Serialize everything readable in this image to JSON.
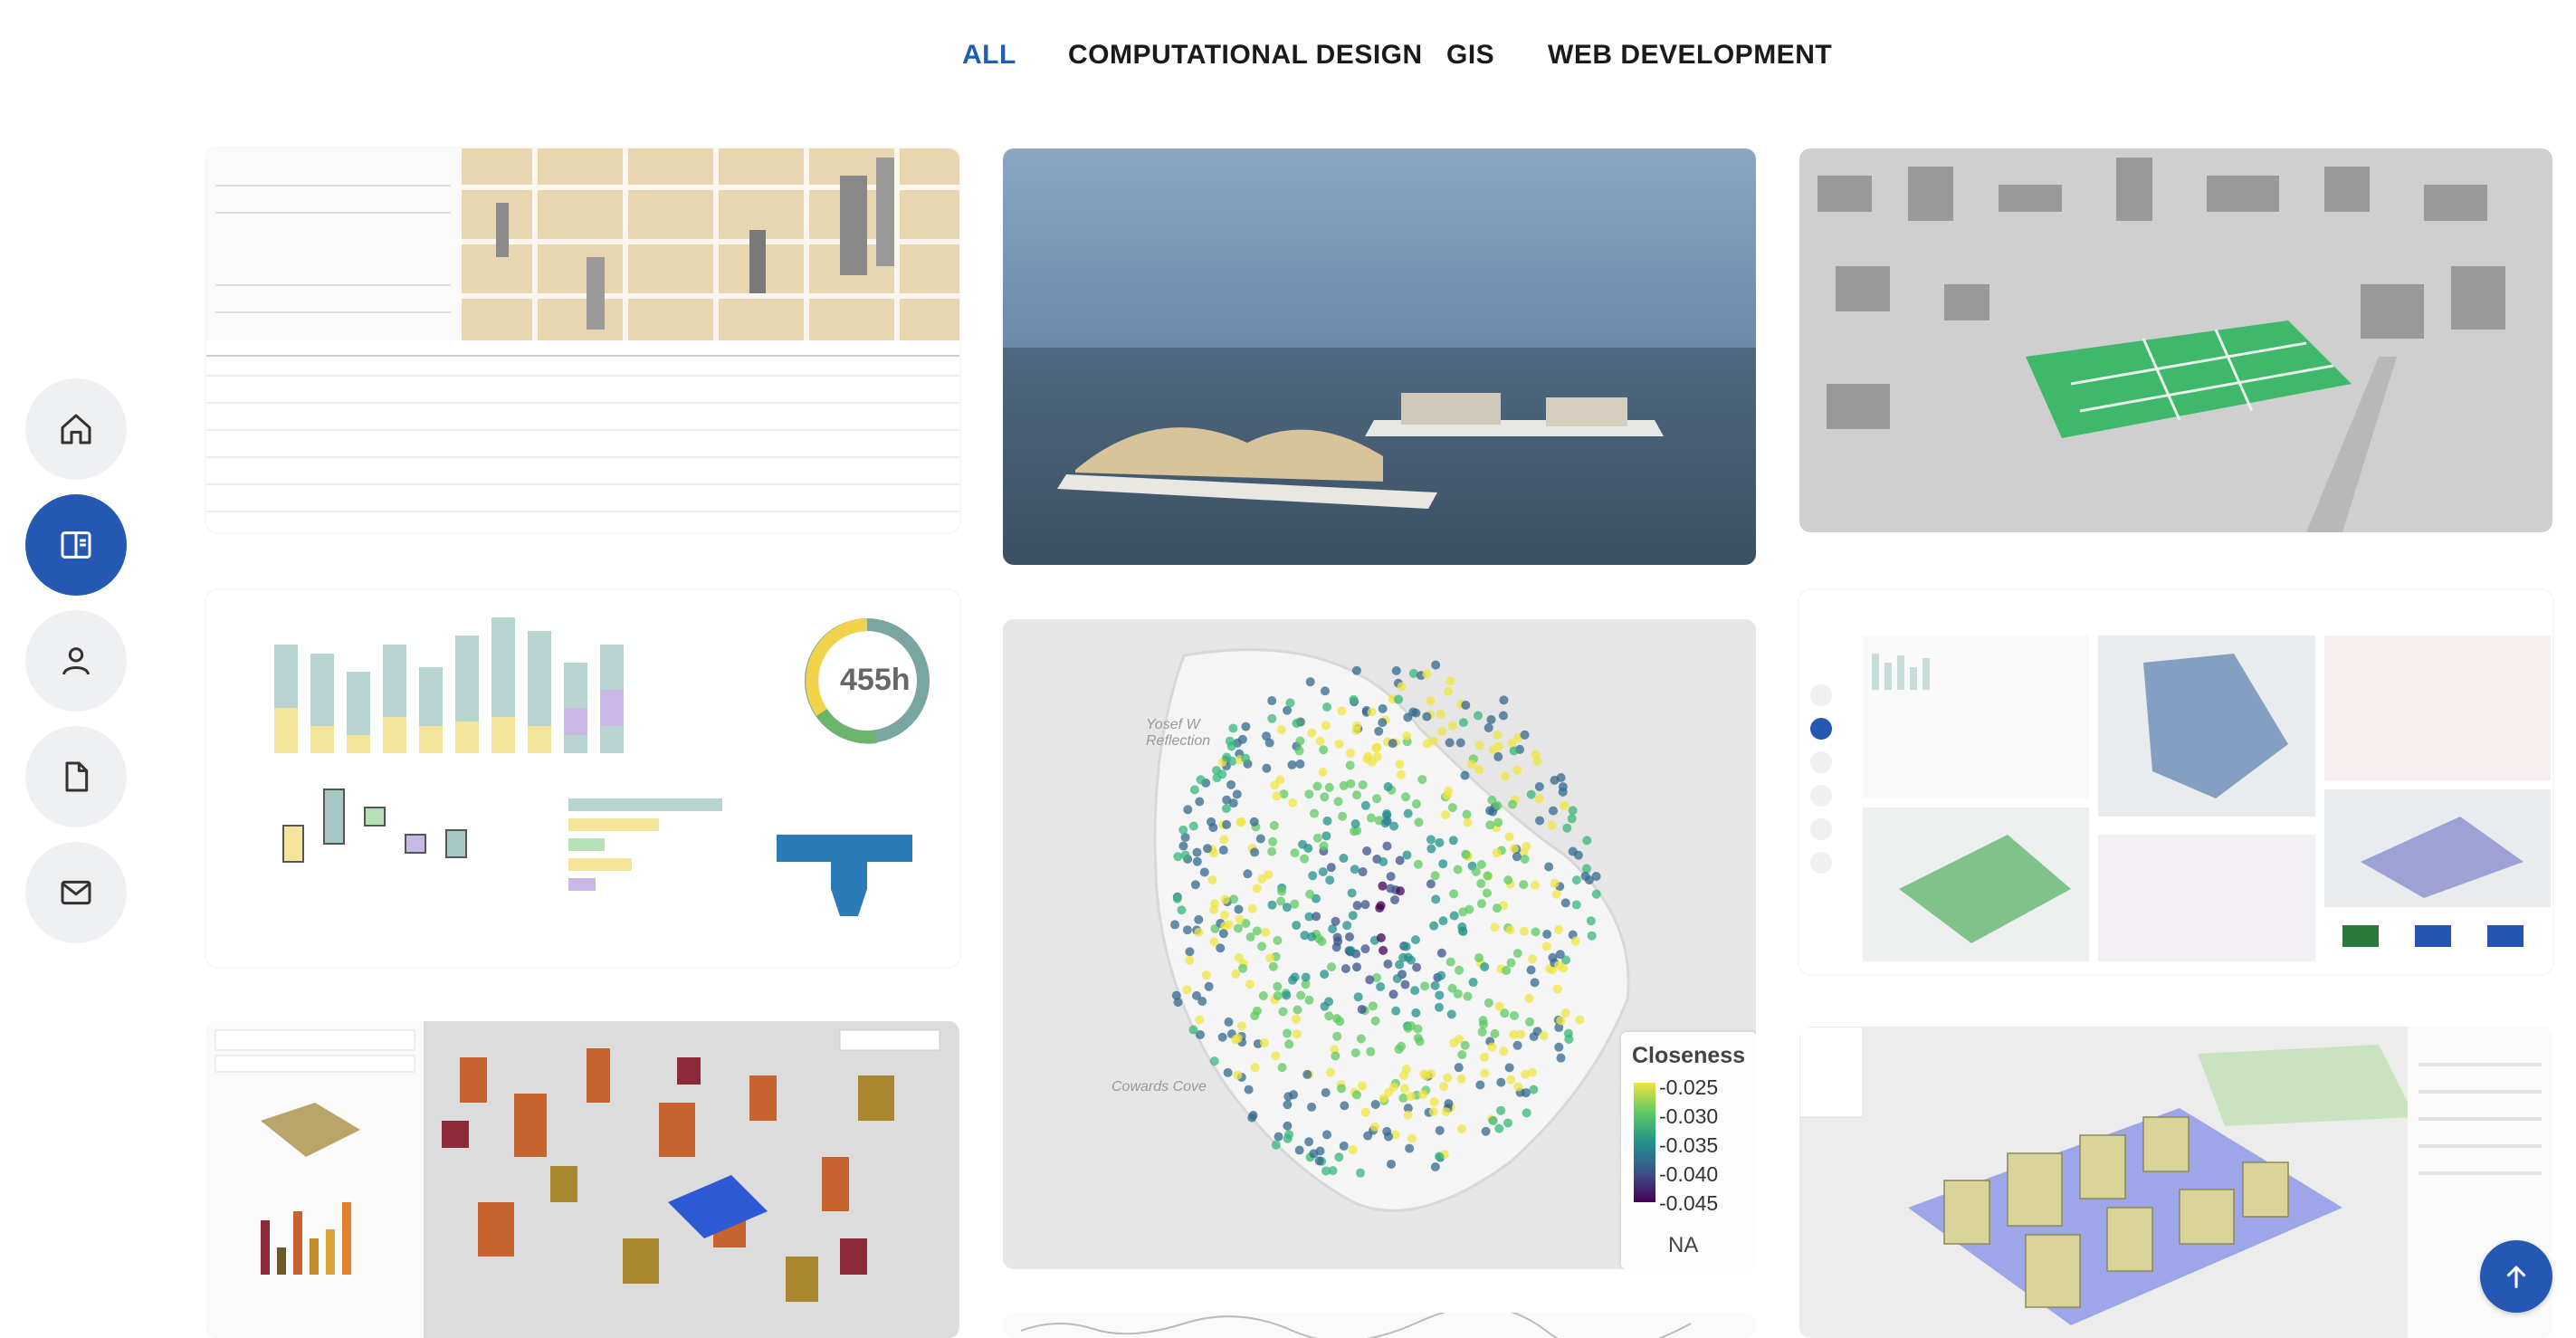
{
  "filters": {
    "all": "ALL",
    "computational_design": "COMPUTATIONAL DESIGN",
    "gis": "GIS",
    "web_development": "WEB DEVELOPMENT",
    "active": "ALL",
    "active_color": "#1f5fb0"
  },
  "sidebar": {
    "items": [
      {
        "icon": "home-icon"
      },
      {
        "icon": "portfolio-icon",
        "active": true
      },
      {
        "icon": "user-icon"
      },
      {
        "icon": "document-icon"
      },
      {
        "icon": "mail-icon"
      }
    ],
    "accent": "#2458b3"
  },
  "gallery": {
    "tiles": [
      {
        "name": "real-estate-feasibility-dashboard"
      },
      {
        "name": "floating-architecture-render"
      },
      {
        "name": "3d-city-green-parcels"
      },
      {
        "name": "time-tracking-dashboard",
        "donut_label": "455h"
      },
      {
        "name": "closeness-centrality-map"
      },
      {
        "name": "portfolio-website-preview"
      },
      {
        "name": "zoning-3d-massing-tool"
      },
      {
        "name": "residential-massing-generator"
      }
    ],
    "closeness_legend": {
      "title": "Closeness",
      "ticks": [
        "-0.025",
        "-0.030",
        "-0.035",
        "-0.040",
        "-0.045"
      ],
      "na": "NA"
    },
    "map_labels": {
      "reflection": "Yosef W Reflection",
      "cove": "Cowards Cove"
    }
  },
  "scroll_top": {
    "icon": "arrow-up-icon"
  }
}
